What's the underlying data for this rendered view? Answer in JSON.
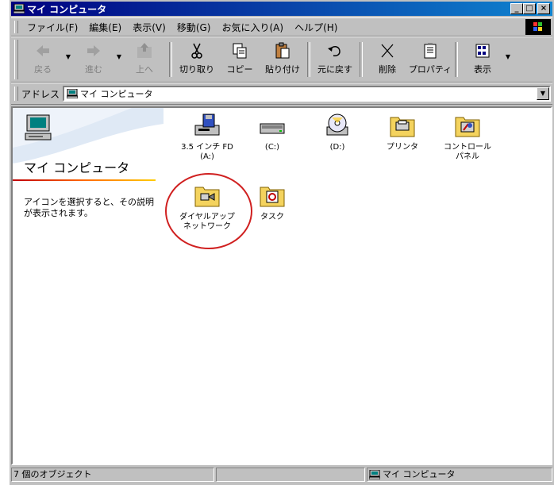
{
  "window": {
    "title": "マイ コンピュータ",
    "title_icon": "computer-icon",
    "minimize_label": "_",
    "maximize_label": "□",
    "close_label": "×"
  },
  "menu": {
    "items": [
      {
        "label": "ファイル(F)"
      },
      {
        "label": "編集(E)"
      },
      {
        "label": "表示(V)"
      },
      {
        "label": "移動(G)"
      },
      {
        "label": "お気に入り(A)"
      },
      {
        "label": "ヘルプ(H)"
      }
    ]
  },
  "toolbar": {
    "back": "戻る",
    "forward": "進む",
    "up": "上へ",
    "cut": "切り取り",
    "copy": "コピー",
    "paste": "貼り付け",
    "undo": "元に戻す",
    "delete": "削除",
    "properties": "プロパティ",
    "views": "表示",
    "dropdown_arrow": "▼"
  },
  "address": {
    "label": "アドレス",
    "value": "マイ コンピュータ"
  },
  "left_pane": {
    "title": "マイ コンピュータ",
    "description": "アイコンを選択すると、その説明が表示されます。"
  },
  "icons": [
    {
      "label": "3.5 インチ FD\n(A:)",
      "icon": "floppy-drive-icon"
    },
    {
      "label": "(C:)",
      "icon": "hard-drive-icon"
    },
    {
      "label": "(D:)",
      "icon": "cd-drive-icon"
    },
    {
      "label": "プリンタ",
      "icon": "printers-folder-icon"
    },
    {
      "label": "コントロール\nパネル",
      "icon": "control-panel-folder-icon"
    },
    {
      "label": "ダイヤルアップ\nネットワーク",
      "icon": "dialup-networking-folder-icon"
    },
    {
      "label": "タスク",
      "icon": "scheduled-tasks-folder-icon"
    }
  ],
  "status": {
    "count": "7 個のオブジェクト",
    "zone": "マイ コンピュータ"
  },
  "colors": {
    "title_bar_start": "#000080",
    "title_bar_end": "#1084d0",
    "highlight_circle": "#d02020",
    "folder": "#f4d35e"
  }
}
